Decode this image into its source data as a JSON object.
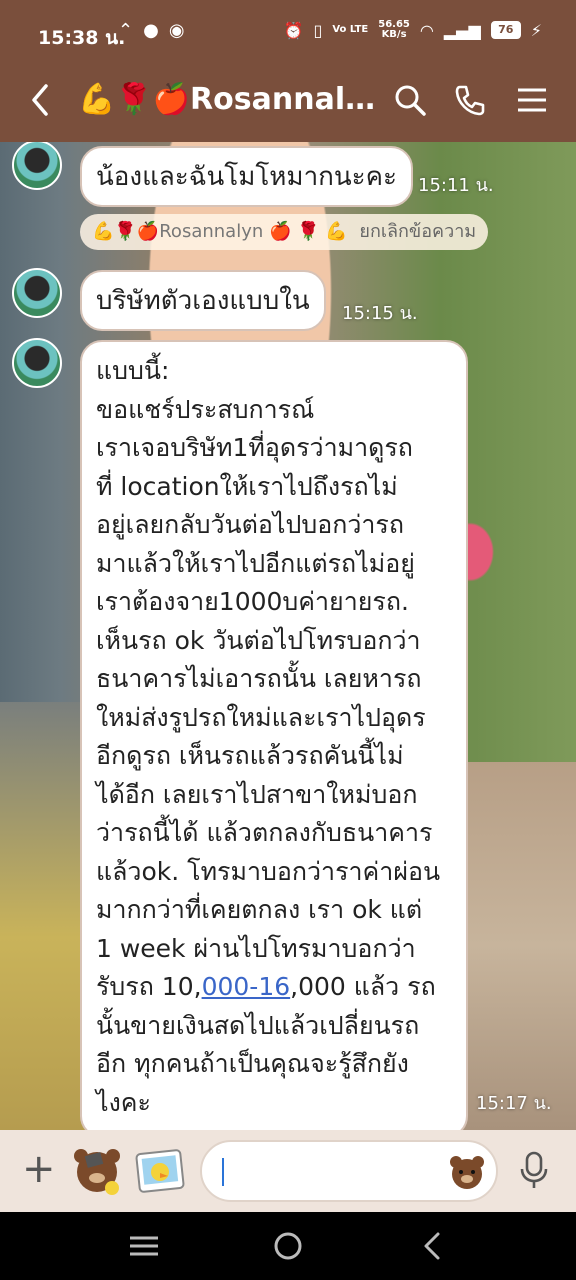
{
  "status": {
    "time": "15:38 น.",
    "net_speed_value": "56.65",
    "net_speed_unit": "KB/s",
    "volte": "Vo LTE",
    "battery": "76"
  },
  "header": {
    "title": "💪🌹🍎Rosannalyn...",
    "icons": [
      "back-icon",
      "search-icon",
      "phone-icon",
      "menu-icon"
    ]
  },
  "messages": [
    {
      "text": "น้องและฉันโมโหมากนะคะ",
      "time": "15:11 น."
    },
    {
      "text": "บริษัทตัวเองแบบใน",
      "time": "15:15 น."
    },
    {
      "text_before_link": "แบบนี้:\nขอแชร์ประสบการณ์\nเราเจอบริษัท1ที่อุดรว่ามาดูรถ\nที่ locationให้เราไปถึงรถไม่\nอยู่เลยกลับวันต่อไปบอกว่ารถ\nมาแล้วให้เราไปอีกแต่รถไม่อยู่\nเราต้องจาย1000บค่ายายรถ.\nเห็นรถ ok วันต่อไปโทรบอกว่า\nธนาคารไม่เอารถนั้น เลยหารถ\nใหม่ส่งรูปรถใหม่และเราไปอุดร\nอีกดูรถ เห็นรถแล้วรถคันนี้ไม่\nได้อีก เลยเราไปสาขาใหม่บอก\nว่ารถนี้ได้ แล้วตกลงกับธนาคาร\nแล้วok. โทรมาบอกว่าราค่าผ่อน\nมากกว่าที่เคยตกลง เรา ok แต่\n1 week ผ่านไปโทรมาบอกว่า\nรับรถ 10,",
      "link": "000-16",
      "text_after_link": ",000 แล้ว รถ\nนั้นขายเงินสดไปแล้วเปลี่ยนรถ\nอีก ทุกคนถ้าเป็นคุณจะรู้สึกยัง\nไงคะ",
      "time": "15:17 น."
    }
  ],
  "notice": {
    "sender": "💪🌹🍎Rosannalyn 🍎 🌹 💪",
    "action": "ยกเลิกข้อความ"
  },
  "input": {
    "placeholder": "",
    "icons": [
      "plus-icon",
      "sticker-icon",
      "photo-sticker-icon",
      "emoji-bear-icon",
      "microphone-icon"
    ]
  },
  "colors": {
    "header_bg": "#7a4f3c",
    "bubble_border": "#d7c3b7",
    "link": "#3a66c8",
    "input_bar_bg": "#efe4dc"
  }
}
